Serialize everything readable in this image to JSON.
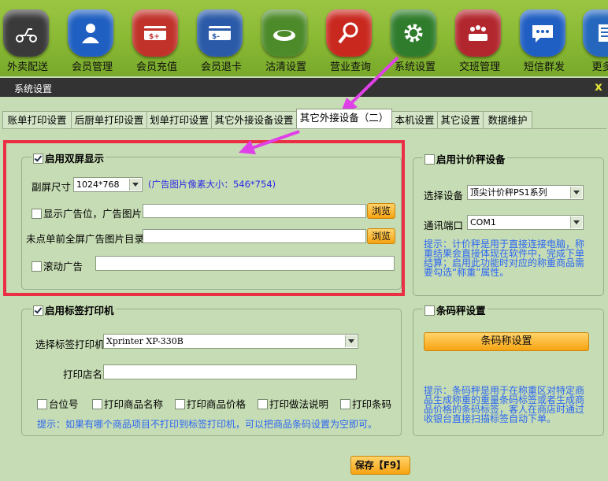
{
  "toolbar": {
    "items": [
      {
        "label": "外卖配送",
        "icon": "scooter-icon",
        "color": "#3a3a3a"
      },
      {
        "label": "会员管理",
        "icon": "member-icon",
        "color": "#1f5fc1"
      },
      {
        "label": "会员充值",
        "icon": "recharge-card-icon",
        "color": "#c0322a"
      },
      {
        "label": "会员退卡",
        "icon": "refund-card-icon",
        "color": "#2a5aa8"
      },
      {
        "label": "沽清设置",
        "icon": "plate-icon",
        "color": "#4d8b2a"
      },
      {
        "label": "营业查询",
        "icon": "search-icon",
        "color": "#c9281f"
      },
      {
        "label": "系统设置",
        "icon": "gear-icon",
        "color": "#2f7d2c"
      },
      {
        "label": "交班管理",
        "icon": "meeting-icon",
        "color": "#b2262d"
      },
      {
        "label": "短信群发",
        "icon": "message-icon",
        "color": "#1f5ec2"
      },
      {
        "label": "更多功",
        "icon": "more-icon",
        "color": "#2467bd"
      }
    ]
  },
  "dialog": {
    "title": "系统设置",
    "close": "x"
  },
  "tabs": [
    "账单打印设置",
    "后厨单打印设置",
    "划单打印设置",
    "其它外接设备设置",
    "其它外接设备（二）",
    "本机设置",
    "其它设置",
    "数据维护"
  ],
  "active_tab": 4,
  "dual_screen": {
    "title": "启用双屏显示",
    "enabled": true,
    "resolution_label": "副屏尺寸",
    "resolution_value": "1024*768",
    "pixel_hint": "(广告图片像素大小：546*754)",
    "show_ad_label": "显示广告位，广告图片",
    "show_ad_checked": false,
    "ad_image_path": "",
    "browse1": "浏览",
    "fullscreen_dir_label": "未点单前全屏广告图片目录",
    "fullscreen_dir_path": "",
    "browse2": "浏览",
    "scroll_ad_label": "滚动广告",
    "scroll_ad_checked": false,
    "scroll_ad_text": ""
  },
  "scale": {
    "title": "启用计价秤设备",
    "enabled": false,
    "device_label": "选择设备",
    "device_value": "顶尖计价秤PS1系列",
    "port_label": "通讯端口",
    "port_value": "COM1",
    "tip_lines": [
      "提示：计价秤是用于直接连接电脑，称",
      "重结果会直接体现在软件中，完成下单",
      "结算；启用此功能时对应的称重商品需",
      "要勾选“称重”属性。"
    ]
  },
  "label_printer": {
    "title": "启用标签打印机",
    "enabled": true,
    "printer_label": "选择标签打印机",
    "printer_value": "Xprinter XP-330B",
    "shop_label": "打印店名",
    "shop_value": "",
    "options": [
      "台位号",
      "打印商品名称",
      "打印商品价格",
      "打印做法说明",
      "打印条码"
    ],
    "tip": "提示：如果有哪个商品项目不打印到标签打印机，可以把商品条码设置为空即可。"
  },
  "barcode_scale": {
    "title": "条码秤设置",
    "enabled": false,
    "button": "条码称设置",
    "tip_lines": [
      "提示：条码秤是用于在称重区对特定商",
      "品生成称重的重量条码标签或者生成商",
      "品价格的条码标签，客人在商店时通过",
      "收银台直接扫描标签自动下单。"
    ]
  },
  "save_button": "保存【F9】",
  "colors": {
    "toolbar_green": "#8cbb36",
    "dialog_bg": "#c6dcb4",
    "highlight_red": "#ea2f45",
    "arrow_magenta": "#e040e8",
    "hint_blue": "#2b66f2",
    "button_orange": "#f7a312"
  }
}
